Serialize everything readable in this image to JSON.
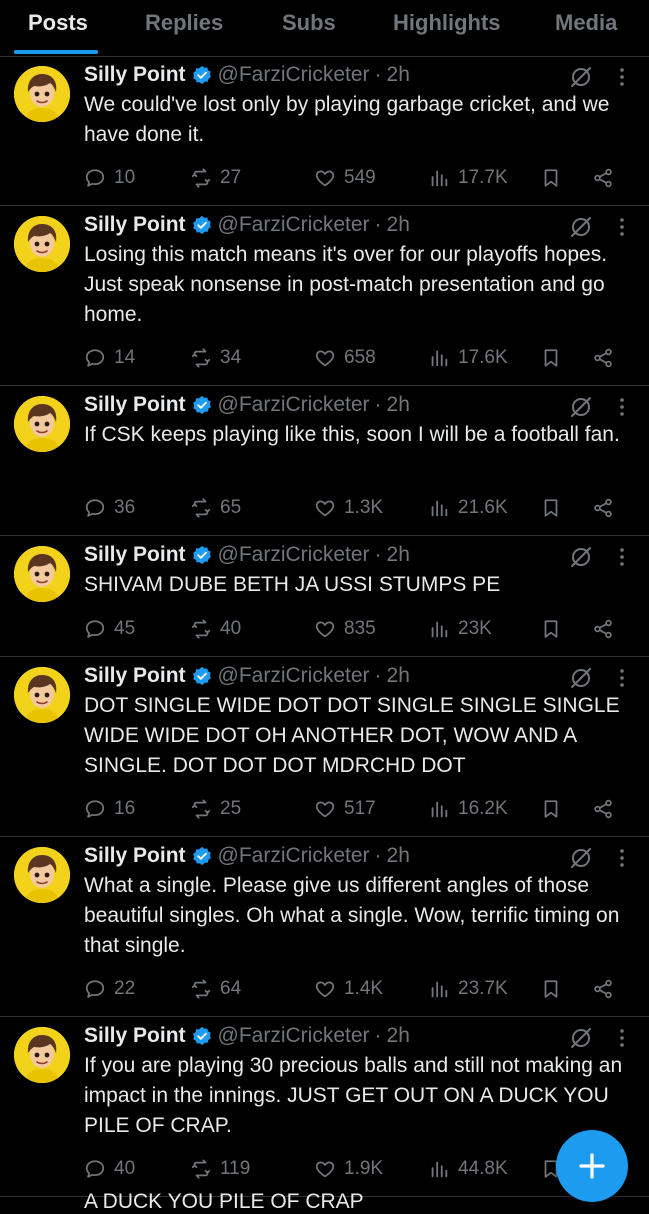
{
  "tabs": [
    {
      "label": "Posts",
      "active": true
    },
    {
      "label": "Replies",
      "active": false
    },
    {
      "label": "Subs",
      "active": false
    },
    {
      "label": "Highlights",
      "active": false
    },
    {
      "label": "Media",
      "active": false
    }
  ],
  "colors": {
    "accent": "#1d9bf0",
    "muted": "#71767b",
    "text": "#e7e9ea",
    "divider": "#2f3336",
    "avatar_bg": "#f2d21b"
  },
  "author": {
    "name": "Silly Point",
    "handle": "@FarziCricketer",
    "dot": "·",
    "verified": true
  },
  "tweets": [
    {
      "time": "2h",
      "text": "We could've lost only by playing garbage cricket, and we have done it.",
      "replies": "10",
      "reposts": "27",
      "likes": "549",
      "views": "17.7K"
    },
    {
      "time": "2h",
      "text": "Losing this match means it's over for our playoffs hopes. Just speak nonsense in post-match presentation and go home.",
      "replies": "14",
      "reposts": "34",
      "likes": "658",
      "views": "17.6K"
    },
    {
      "time": "2h",
      "text": "If CSK keeps playing like this, soon I will be a football fan.",
      "replies": "36",
      "reposts": "65",
      "likes": "1.3K",
      "views": "21.6K"
    },
    {
      "time": "2h",
      "text": "SHIVAM DUBE BETH JA USSI STUMPS PE",
      "replies": "45",
      "reposts": "40",
      "likes": "835",
      "views": "23K"
    },
    {
      "time": "2h",
      "text": "DOT SINGLE WIDE DOT DOT SINGLE SINGLE SINGLE WIDE WIDE DOT OH ANOTHER DOT, WOW AND A SINGLE. DOT DOT DOT MDRCHD DOT",
      "replies": "16",
      "reposts": "25",
      "likes": "517",
      "views": "16.2K"
    },
    {
      "time": "2h",
      "text": "What a single. Please give us different angles of those beautiful singles. Oh what a single. Wow, terrific timing on that single.",
      "replies": "22",
      "reposts": "64",
      "likes": "1.4K",
      "views": "23.7K"
    },
    {
      "time": "2h",
      "text": "If you are playing 30 precious balls and still not making an impact in the innings. JUST GET OUT ON A DUCK YOU PILE OF CRAP.",
      "replies": "40",
      "reposts": "119",
      "likes": "1.9K",
      "views": "44.8K"
    }
  ],
  "peek_text": "A DUCK YOU PILE OF CRAP",
  "icons": {
    "reply": "reply-icon",
    "repost": "repost-icon",
    "like": "heart-icon",
    "views": "views-icon",
    "bookmark": "bookmark-icon",
    "share": "share-icon",
    "grok": "grok-icon",
    "more": "more-icon",
    "verified": "verified-badge-icon",
    "compose": "plus-icon"
  }
}
